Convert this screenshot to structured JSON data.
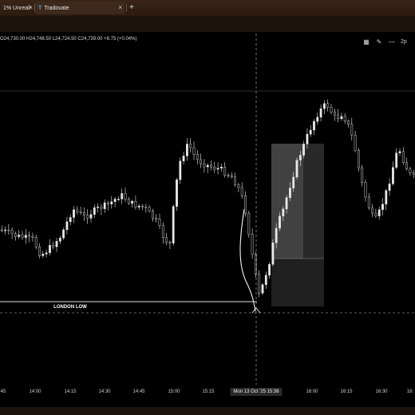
{
  "browser": {
    "tabs": [
      {
        "label": "1% Unreali",
        "active": false
      },
      {
        "label": "Tradovate",
        "active": true
      }
    ],
    "close_glyph": "×",
    "new_tab_glyph": "+"
  },
  "chart_header": {
    "ohlc_text": "O24,730.00  H24,748.50  L24,724.50  C24,739.00  +8.75 (+0.04%)",
    "right_label": "2p"
  },
  "icons": [
    "grid-icon",
    "pencil-icon",
    "line-tool-icon"
  ],
  "annotations": {
    "level_label": "LONDON LOW"
  },
  "x_axis": {
    "ticks": [
      {
        "label": "45"
      },
      {
        "label": "14:00"
      },
      {
        "label": "14:15"
      },
      {
        "label": "14:30"
      },
      {
        "label": "14:45"
      },
      {
        "label": "15:00"
      },
      {
        "label": "15:15"
      },
      {
        "label": "16:00"
      },
      {
        "label": "16:15"
      },
      {
        "label": "16:30"
      },
      {
        "label": "16:"
      }
    ],
    "crosshair_label": "Mon 13 Oct '25   15:36"
  },
  "colors": {
    "background": "#000000",
    "candle": "#e8e8e8",
    "box_light": "#4a4a4a",
    "box_dark": "#2a2a2a",
    "browser_chrome": "#2b1a10"
  },
  "chart_data": {
    "type": "candlestick",
    "title": "",
    "xlabel": "",
    "ylabel": "",
    "price_line": 24739.0
  }
}
